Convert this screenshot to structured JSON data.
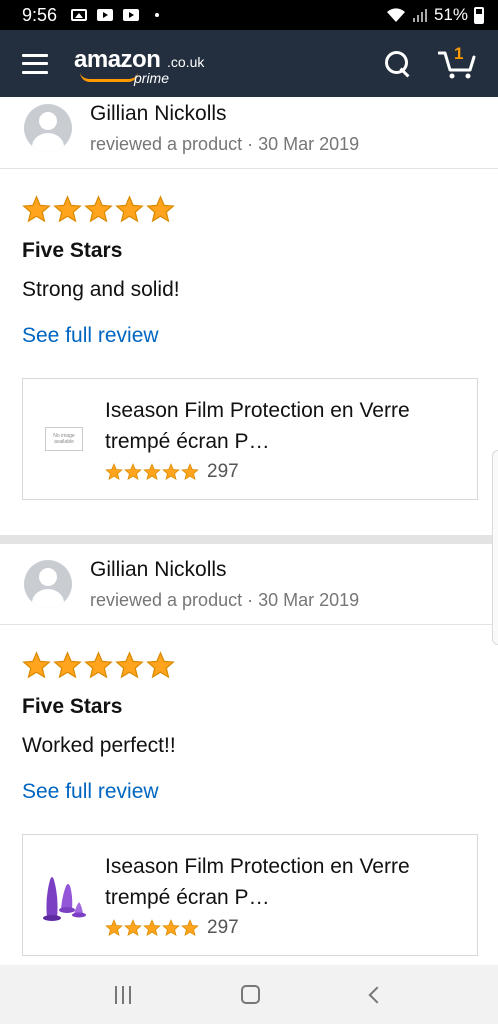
{
  "status_bar": {
    "time": "9:56",
    "battery": "51%"
  },
  "header": {
    "logo_word": "amazon",
    "logo_tld": ".co.uk",
    "logo_prime": "prime",
    "cart_count": "1"
  },
  "colors": {
    "header_bg": "#232f3e",
    "accent": "#ff9900",
    "link": "#0066c0",
    "star": "#ffa41c"
  },
  "reviews": [
    {
      "reviewer_name": "Gillian Nickolls",
      "reviewer_meta": "reviewed a product · 30 Mar 2019",
      "rating": 5,
      "title": "Five Stars",
      "text": "Strong and solid!",
      "see_full": "See full review",
      "product": {
        "title": "Iseason Film Protection en Verre trempé écran P…",
        "rating": 5,
        "rating_count": "297",
        "image": "no-image",
        "no_image_line1": "No image",
        "no_image_line2": "available"
      }
    },
    {
      "reviewer_name": "Gillian Nickolls",
      "reviewer_meta": "reviewed a product · 30 Mar 2019",
      "rating": 5,
      "title": "Five Stars",
      "text": "Worked perfect!!",
      "see_full": "See full review",
      "product": {
        "title": "Iseason Film Protection en Verre trempé écran P…",
        "rating": 5,
        "rating_count": "297",
        "image": "purple-product-thumbnail"
      }
    }
  ]
}
